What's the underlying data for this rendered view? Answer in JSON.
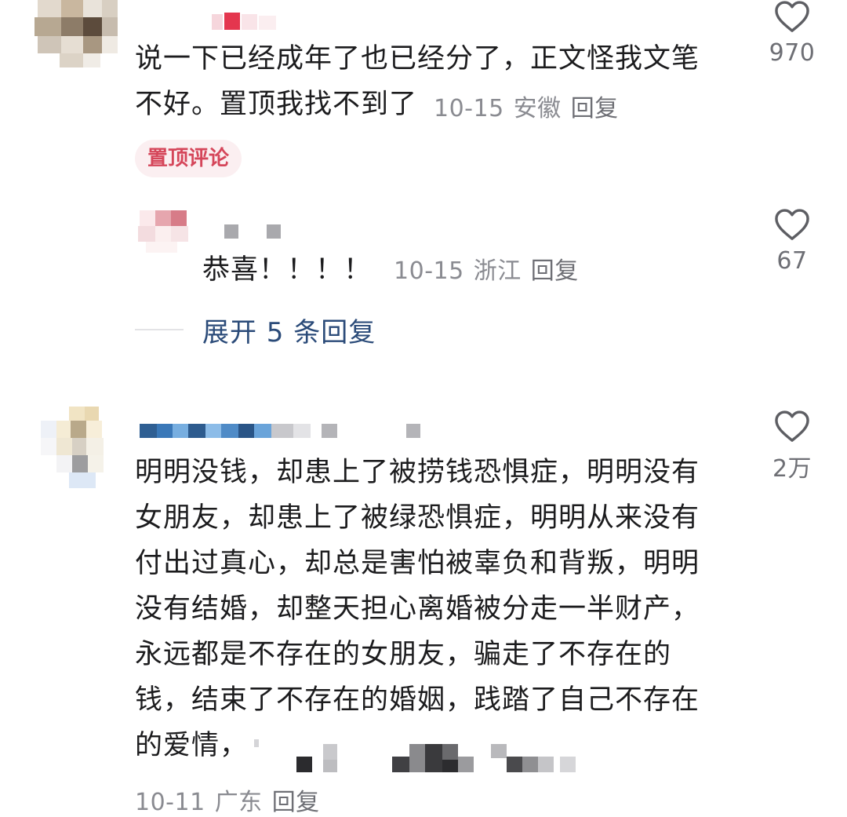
{
  "comments": [
    {
      "text": "说一下已经成年了也已经分了，正文怪我文笔\n不好。置顶我找不到了",
      "date": "10-15",
      "location": "安徽",
      "reply_label": "回复",
      "likes": "970",
      "badge": "置顶评论"
    },
    {
      "text": "恭喜！！！！",
      "date": "10-15",
      "location": "浙江",
      "reply_label": "回复",
      "likes": "67"
    },
    {
      "text": "明明没钱，却患上了被捞钱恐惧症，明明没有\n女朋友，却患上了被绿恐惧症，明明从来没有\n付出过真心，却总是害怕被辜负和背叛，明明\n没有结婚，却整天担心离婚被分走一半财产，\n永远都是不存在的女朋友，骗走了不存在的\n钱，结束了不存在的婚姻，践踏了自己不存在\n的爱情，",
      "date": "10-11",
      "location": "广东",
      "reply_label": "回复",
      "likes": "2万"
    }
  ],
  "expand_replies": "展开 5 条回复",
  "icons": {
    "like": "heart-outline-icon"
  },
  "colors": {
    "text": "#1c1c1e",
    "meta": "#8a8b91",
    "badge_bg": "#fbeff1",
    "badge_fg": "#d5465a",
    "expand": "#2b4b79"
  }
}
